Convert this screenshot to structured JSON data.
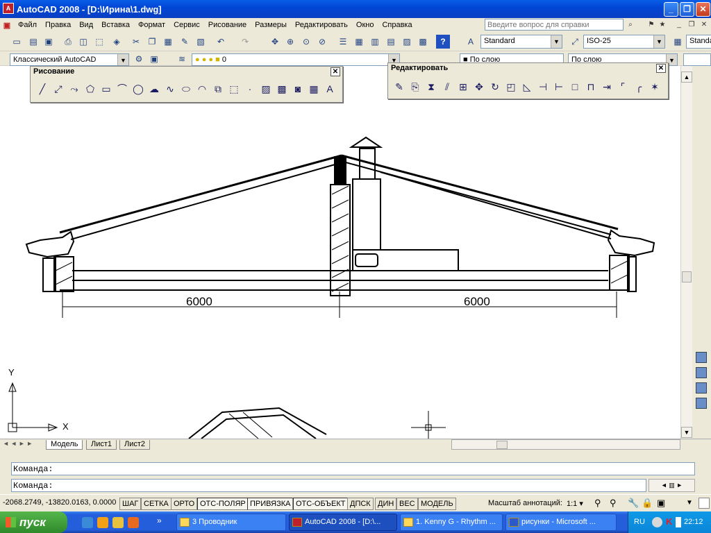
{
  "window": {
    "title": "AutoCAD 2008 - [D:\\Ирина\\1.dwg]"
  },
  "menu": [
    "Файл",
    "Правка",
    "Вид",
    "Вставка",
    "Формат",
    "Сервис",
    "Рисование",
    "Размеры",
    "Редактировать",
    "Окно",
    "Справка"
  ],
  "help": {
    "placeholder": "Введите вопрос для справки"
  },
  "toolbar": {
    "text_style": "Standard",
    "dim_style": "ISO-25",
    "table_style": "Standa",
    "workspace": "Классический AutoCAD",
    "layer": "0",
    "linetype_1": "По слою",
    "linetype_2": "По слою"
  },
  "panels": {
    "draw": {
      "title": "Рисование",
      "close": "✕"
    },
    "modify": {
      "title": "Редактировать",
      "close": "✕"
    }
  },
  "drawing": {
    "dim_left": "6000",
    "dim_right": "6000"
  },
  "ucs": {
    "x": "X",
    "y": "Y"
  },
  "tabs": [
    "Модель",
    "Лист1",
    "Лист2"
  ],
  "command": {
    "line1": "Команда:",
    "line2": "Команда:"
  },
  "status": {
    "coords": "-2068.2749, -13820.0163, 0.0000",
    "toggles": [
      "ШАГ",
      "СЕТКА",
      "ОРТО",
      "ОТС-ПОЛЯР",
      "ПРИВЯЗКА",
      "ОТС-ОБЪЕКТ",
      "ДПСК",
      "ДИН",
      "ВЕС",
      "МОДЕЛЬ"
    ],
    "annotation_label": "Масштаб аннотаций:",
    "annotation_scale": "1:1"
  },
  "taskbar": {
    "start": "пуск",
    "tasks": [
      "3 Проводник",
      "AutoCAD 2008 - [D:\\...",
      "1. Kenny G - Rhythm ...",
      "рисунки - Microsoft ..."
    ],
    "lang": "RU",
    "clock": "22:12"
  }
}
